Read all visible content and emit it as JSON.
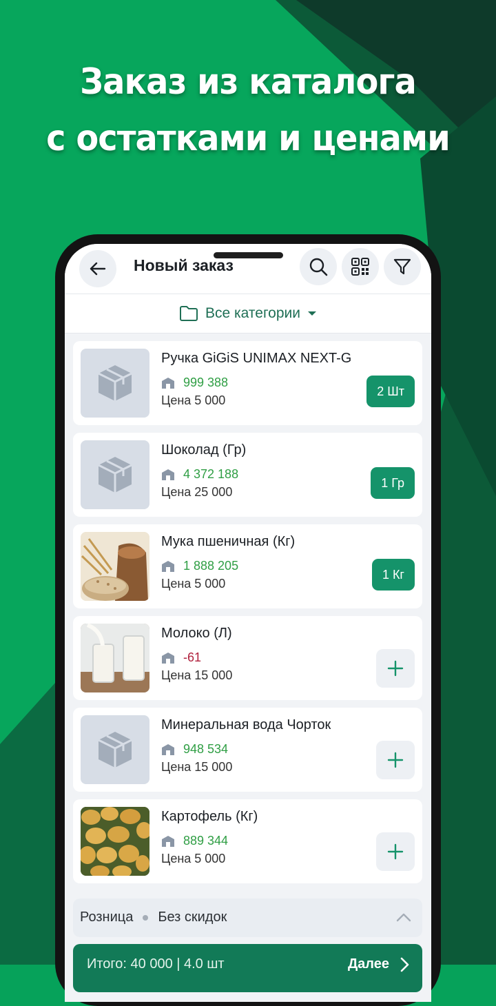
{
  "headline": {
    "line1": "Заказ из каталога",
    "line2": "с остатками и ценами"
  },
  "colors": {
    "brand_green": "#06a25a",
    "dark_green": "#0e3a2a",
    "accent_button": "#15936a",
    "stock_positive": "#2f9e44",
    "stock_negative": "#b0203c"
  },
  "appbar": {
    "back_icon": "arrow-left-icon",
    "title": "Новый заказ",
    "actions": [
      "search-icon",
      "qr-code-icon",
      "filter-icon"
    ]
  },
  "category_filter": {
    "icon": "folder-icon",
    "label": "Все категории",
    "dropdown_icon": "caret-down-icon"
  },
  "products": [
    {
      "name": "Ручка GiGiS UNIMAX NEXT-G",
      "stock": "999 388",
      "stock_status": "positive",
      "price": "Цена 5 000",
      "qty": "2 Шт",
      "image": "placeholder-box"
    },
    {
      "name": "Шоколад (Гр)",
      "stock": "4 372 188",
      "stock_status": "positive",
      "price": "Цена 25 000",
      "qty": "1 Гр",
      "image": "placeholder-box"
    },
    {
      "name": "Мука пшеничная (Кг)",
      "stock": "1 888 205",
      "stock_status": "positive",
      "price": "Цена 5 000",
      "qty": "1 Кг",
      "image": "flour-photo"
    },
    {
      "name": "Молоко (Л)",
      "stock": "-61",
      "stock_status": "negative",
      "price": "Цена 15 000",
      "qty": null,
      "image": "milk-photo"
    },
    {
      "name": "Минеральная вода Чорток",
      "stock": "948 534",
      "stock_status": "positive",
      "price": "Цена 15 000",
      "qty": null,
      "image": "placeholder-box"
    },
    {
      "name": "Картофель (Кг)",
      "stock": "889 344",
      "stock_status": "positive",
      "price": "Цена 5 000",
      "qty": null,
      "image": "potato-photo"
    }
  ],
  "price_type": {
    "type": "Розница",
    "discount": "Без скидок",
    "toggle_icon": "chevron-up-icon"
  },
  "footer": {
    "total": "Итого: 40 000 | 4.0 шт",
    "next_label": "Далее",
    "next_icon": "chevron-right-icon"
  }
}
